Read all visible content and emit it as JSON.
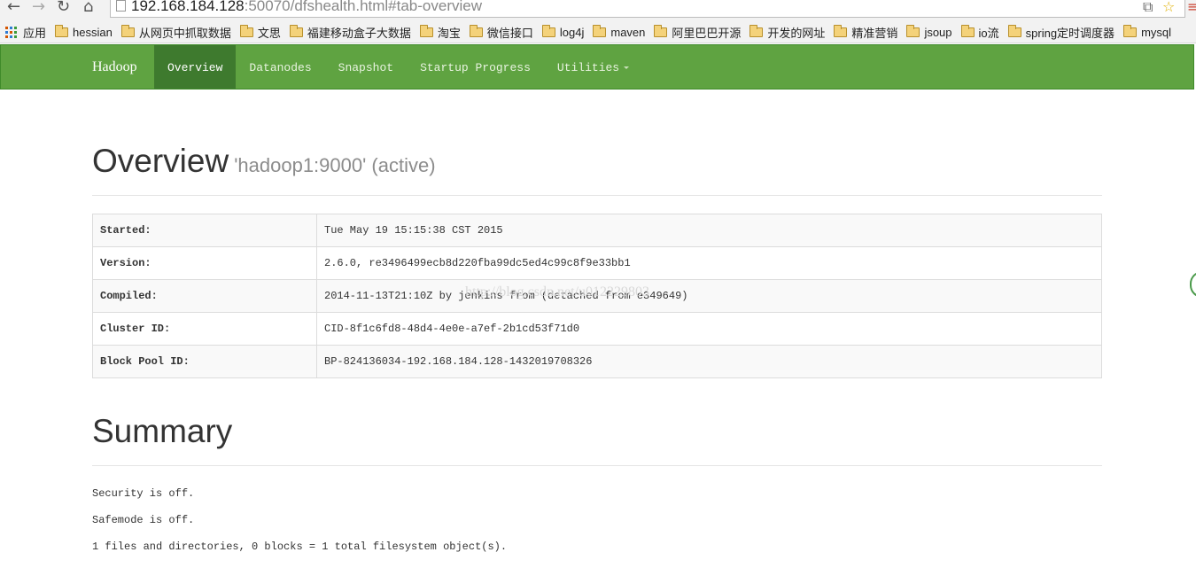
{
  "browser": {
    "url_host": "192.168.184.128",
    "url_rest": ":50070/dfshealth.html#tab-overview",
    "nav": {
      "back_icon": "back-arrow-icon",
      "forward_icon": "forward-arrow-icon",
      "reload_icon": "reload-icon",
      "home_icon": "home-icon"
    },
    "right_icons": [
      "translate-icon",
      "star-icon",
      "menu-icon"
    ]
  },
  "bookmarks": {
    "apps_label": "应用",
    "items": [
      "hessian",
      "从网页中抓取数据",
      "文思",
      "福建移动盒子大数据",
      "淘宝",
      "微信接口",
      "log4j",
      "maven",
      "阿里巴巴开源",
      "开发的网址",
      "精准营销",
      "jsoup",
      "io流",
      "spring定时调度器",
      "mysql"
    ]
  },
  "navbar": {
    "brand": "Hadoop",
    "tabs": [
      {
        "label": "Overview",
        "active": true
      },
      {
        "label": "Datanodes",
        "active": false
      },
      {
        "label": "Snapshot",
        "active": false
      },
      {
        "label": "Startup Progress",
        "active": false
      },
      {
        "label": "Utilities",
        "active": false,
        "dropdown": true
      }
    ],
    "colors": {
      "bar": "#5fa341",
      "active": "#3e7a2e"
    }
  },
  "overview": {
    "title": "Overview",
    "subtitle": "'hadoop1:9000' (active)",
    "rows": [
      {
        "key": "Started:",
        "value": "Tue May 19 15:15:38 CST 2015"
      },
      {
        "key": "Version:",
        "value": "2.6.0, re3496499ecb8d220fba99dc5ed4c99c8f9e33bb1"
      },
      {
        "key": "Compiled:",
        "value": "2014-11-13T21:10Z by jenkins from (detached from e349649)"
      },
      {
        "key": "Cluster ID:",
        "value": "CID-8f1c6fd8-48d4-4e0e-a7ef-2b1cd53f71d0"
      },
      {
        "key": "Block Pool ID:",
        "value": "BP-824136034-192.168.184.128-1432019708326"
      }
    ],
    "watermark": "http://blog.csdn.net/u012229803"
  },
  "summary": {
    "title": "Summary",
    "lines": [
      "Security is off.",
      "Safemode is off.",
      "1 files and directories, 0 blocks = 1 total filesystem object(s)."
    ]
  }
}
